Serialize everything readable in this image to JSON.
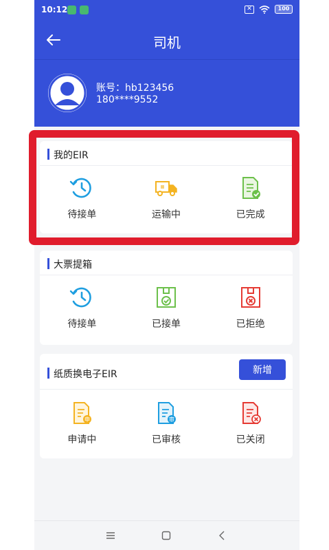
{
  "status_bar": {
    "time": "10:12",
    "battery": "100"
  },
  "header": {
    "title": "司机"
  },
  "profile": {
    "account": "账号：hb123456",
    "phone": "180****9552"
  },
  "sections": {
    "my_eir": {
      "title": "我的EIR",
      "items": [
        {
          "label": "待接单",
          "icon": "clock-refresh-icon"
        },
        {
          "label": "运输中",
          "icon": "truck-icon"
        },
        {
          "label": "已完成",
          "icon": "document-check-icon"
        }
      ]
    },
    "big_ticket": {
      "title": "大票提箱",
      "items": [
        {
          "label": "待接单",
          "icon": "clock-refresh-icon"
        },
        {
          "label": "已接单",
          "icon": "box-check-icon"
        },
        {
          "label": "已拒绝",
          "icon": "box-reject-icon"
        }
      ]
    },
    "paper_eir": {
      "title": "纸质换电子EIR",
      "add_label": "新增",
      "items": [
        {
          "label": "申请中",
          "icon": "document-apply-icon"
        },
        {
          "label": "已审核",
          "icon": "document-review-icon"
        },
        {
          "label": "已关闭",
          "icon": "document-closed-icon"
        }
      ]
    }
  },
  "colors": {
    "primary": "#3550d9",
    "highlight": "#e01c2c",
    "icon_blue": "#1e9ee0",
    "icon_yellow": "#f4b321",
    "icon_green": "#6cc04a",
    "icon_red": "#e53a33"
  }
}
